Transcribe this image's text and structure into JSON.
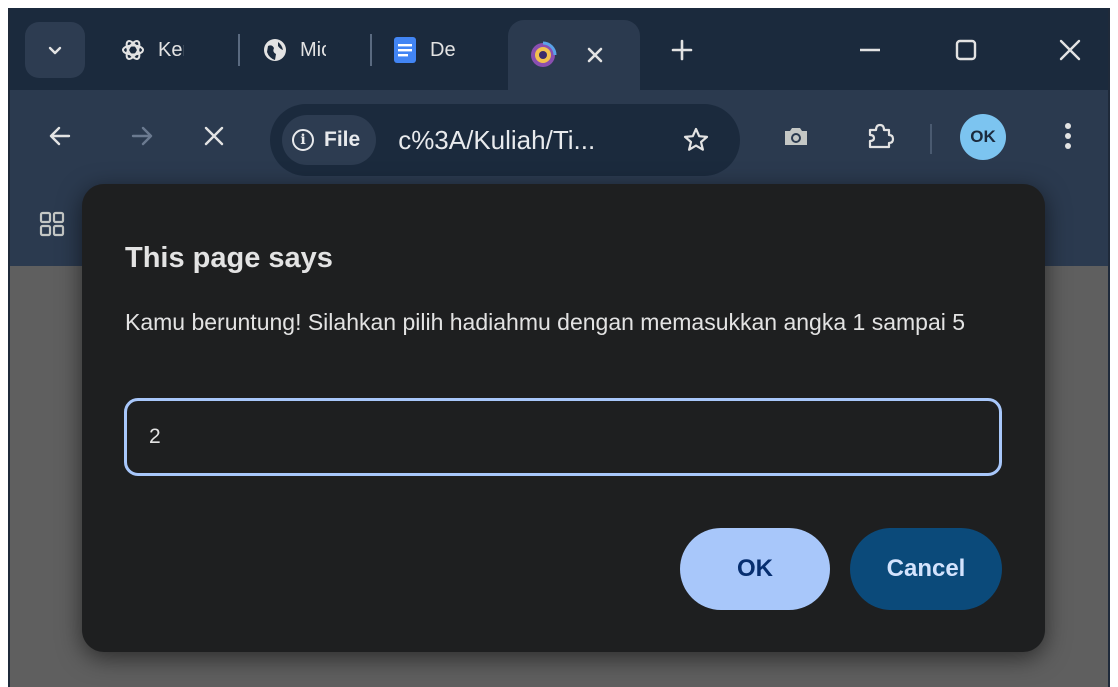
{
  "browser": {
    "tabs": [
      {
        "title": "Ker",
        "icon": "openai-icon"
      },
      {
        "title": "Mic",
        "icon": "globe-icon"
      },
      {
        "title": "Des",
        "icon": "google-docs-icon"
      },
      {
        "title": "",
        "icon": "site-logo-icon",
        "active": true
      }
    ],
    "omnibox": {
      "chip_label": "File",
      "url": "c%3A/Kuliah/Ti..."
    },
    "avatar_initials": "OK"
  },
  "dialog": {
    "title": "This page says",
    "message": "Kamu beruntung! Silahkan pilih hadiahmu dengan memasukkan angka 1 sampai 5",
    "input_value": "2",
    "ok_label": "OK",
    "cancel_label": "Cancel"
  },
  "colors": {
    "accent": "#a8c7fa",
    "dialog_bg": "#1e1f20",
    "frame": "#1b2a3d",
    "toolbar": "#2b3a4f"
  }
}
